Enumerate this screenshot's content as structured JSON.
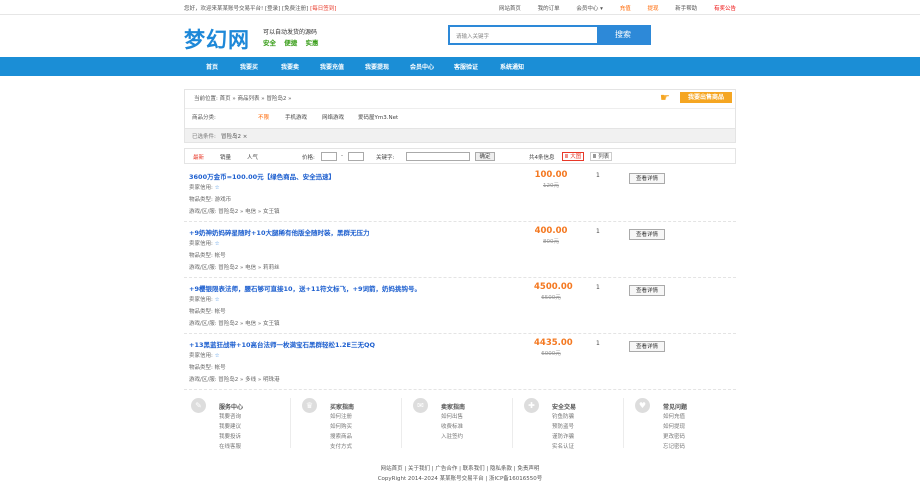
{
  "topbar": {
    "welcome": "您好，欢迎来某某账号交易平台!",
    "login": "[登录]",
    "register": "[免费注册]",
    "checkin": "[每日签到]",
    "links": [
      "网站首页",
      "我的订单",
      "会员中心 ▾",
      "充值",
      "提现",
      "新手帮助",
      "有奖公告"
    ]
  },
  "header": {
    "logo": "梦幻网",
    "slogan": "可以自动发货的源码",
    "slogan2": "安全  便捷  实惠",
    "search_placeholder": "请输入关键字",
    "search_button": "搜索"
  },
  "nav": [
    "首页",
    "我要买",
    "我要卖",
    "我要充值",
    "我要提现",
    "会员中心",
    "客服验证",
    "系统通知"
  ],
  "breadcrumb": {
    "text": "当前位置: 首页 » 商品列表 » 冒险岛2 »",
    "sell_button": "我要出售商品"
  },
  "categories": {
    "label": "商品分类:",
    "items": [
      "不限",
      "手机游戏",
      "网络游戏",
      "爱码屋Ym3.Net"
    ]
  },
  "selected": {
    "label": "已选条件:",
    "value": "冒险岛2 ×"
  },
  "filter": {
    "sorts": [
      "最新",
      "销量",
      "人气"
    ],
    "price_label": "价格:",
    "dash": "-",
    "keyword_label": "关键字:",
    "ok": "确定",
    "count": "共4条信息",
    "view_big": "Ⅲ 大图",
    "view_list": "Ⅲ 列表"
  },
  "items": [
    {
      "title": "3600万金币=100.00元【绿色商品、安全迅速】",
      "seller": "卖家信用:",
      "type": "物品类型:  游戏币",
      "server": "游戏/区/服:  冒险岛2 » 电信 » 女王镇",
      "price": "100.00",
      "old": "120元",
      "qty": "1",
      "btn": "查看详情"
    },
    {
      "title": "+9奶神奶妈碎星随时+10大腿稀有他版全随时装，黑群无压力",
      "seller": "卖家信用:",
      "type": "物品类型:  帐号",
      "server": "游戏/区/服:  冒险岛2 » 电信 » 莉莉丝",
      "price": "400.00",
      "old": "800元",
      "qty": "1",
      "btn": "查看详情"
    },
    {
      "title": "+9樱银限表法师，腰石够可直接10，送+11符文标飞，+9词箭，奶妈挑钩号。",
      "seller": "卖家信用:",
      "type": "物品类型:  帐号",
      "server": "游戏/区/服:  冒险岛2 » 电信 » 女王镇",
      "price": "4500.00",
      "old": "6500元",
      "qty": "1",
      "btn": "查看详情"
    },
    {
      "title": "+13黑蓝狂战带+10高台法师一枚满宝石黑群轻松1.2E三无QQ",
      "seller": "卖家信用:",
      "type": "物品类型:  帐号",
      "server": "游戏/区/服:  冒险岛2 » 多线 » 明珠港",
      "price": "4435.00",
      "old": "6000元",
      "qty": "1",
      "btn": "查看详情"
    }
  ],
  "footer": [
    {
      "title": "服务中心",
      "links": [
        "我要咨询",
        "我要建议",
        "我要投诉",
        "在线客服"
      ]
    },
    {
      "title": "买家指南",
      "links": [
        "如何注册",
        "如何购买",
        "搜索商品",
        "支付方式"
      ]
    },
    {
      "title": "卖家指南",
      "links": [
        "如何出售",
        "收费标准",
        "入驻签约"
      ]
    },
    {
      "title": "安全交易",
      "links": [
        "钓鱼防骗",
        "预防盗号",
        "谨防诈骗",
        "实名认证"
      ]
    },
    {
      "title": "常见问题",
      "links": [
        "如何充值",
        "如何提现",
        "更改密码",
        "忘记密码"
      ]
    }
  ],
  "copyright": {
    "links": "网站首页 | 关于我们 | 广告合作 | 联系我们 | 隐私条款 | 免责声明",
    "text": "CopyRight 2014-2024 某某账号交易平台 | 浙ICP备16016550号"
  }
}
